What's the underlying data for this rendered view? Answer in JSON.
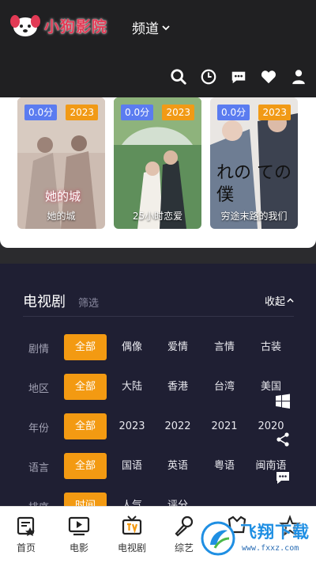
{
  "app": {
    "logo_text": "小狗影院"
  },
  "header": {
    "channel_label": "频道"
  },
  "toolbar": {
    "icons": [
      "search-icon",
      "history-icon",
      "message-icon",
      "favorite-icon",
      "user-icon"
    ]
  },
  "posters": [
    {
      "title": "她的城",
      "score": "0.0分",
      "year": "2023",
      "poster_text": "她的城"
    },
    {
      "title": "25小时恋爱",
      "score": "0.0分",
      "year": "2023",
      "poster_text": ""
    },
    {
      "title": "穷途末路的我们",
      "score": "0.0分",
      "year": "2023",
      "poster_text": "れの ての僕"
    }
  ],
  "filter": {
    "title": "电视剧",
    "subtitle": "筛选",
    "collapse_label": "收起",
    "rows": [
      {
        "label": "剧情",
        "options": [
          "全部",
          "偶像",
          "爱情",
          "言情",
          "古装"
        ]
      },
      {
        "label": "地区",
        "options": [
          "全部",
          "大陆",
          "香港",
          "台湾",
          "美国"
        ]
      },
      {
        "label": "年份",
        "options": [
          "全部",
          "2023",
          "2022",
          "2021",
          "2020"
        ]
      },
      {
        "label": "语言",
        "options": [
          "全部",
          "国语",
          "英语",
          "粤语",
          "闽南语"
        ]
      },
      {
        "label": "排序",
        "options": [
          "时间",
          "人气",
          "评分"
        ]
      }
    ]
  },
  "side_buttons": [
    "windows-icon",
    "share-icon",
    "comment-icon"
  ],
  "bottom_nav": [
    {
      "label": "首页",
      "icon": "home-icon"
    },
    {
      "label": "电影",
      "icon": "movie-icon"
    },
    {
      "label": "电视剧",
      "icon": "tv-icon"
    },
    {
      "label": "综艺",
      "icon": "microphone-icon"
    },
    {
      "label": "",
      "icon": "anime-icon"
    },
    {
      "label": "",
      "icon": "more-icon"
    }
  ],
  "watermark": {
    "text": "飞翔下载",
    "url": "www.fxxz.com"
  },
  "colors": {
    "accent": "#f39a12",
    "score_badge": "#5b7cf0",
    "panel_bg": "#1f1f33",
    "header_bg": "#202022"
  }
}
